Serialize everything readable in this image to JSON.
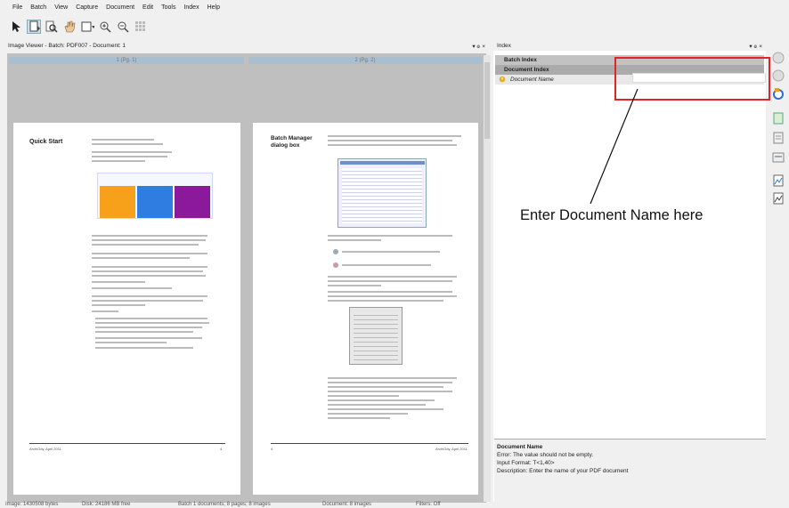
{
  "menu": [
    "File",
    "Batch",
    "View",
    "Capture",
    "Document",
    "Edit",
    "Tools",
    "Index",
    "Help"
  ],
  "toolbar_icons": [
    "arrow-icon",
    "select-page-icon",
    "magnify-icon",
    "hand-icon",
    "fit-page-icon",
    "zoom-in-icon",
    "zoom-out-icon",
    "thumbnails-icon"
  ],
  "viewer": {
    "title": "Image Viewer - Batch: PDF007 - Document: 1",
    "controls": "▾ ๏ ×",
    "page1": {
      "label": "1 (Pg. 1)",
      "heading": "Quick Start",
      "footer_left": "ArchiOdy, April 2011",
      "footer_right": "4"
    },
    "page2": {
      "label": "2 (Pg. 2)",
      "heading": "Batch Manager dialog box",
      "footer_left": "4",
      "footer_right": "ArchiOdy, April 2011"
    }
  },
  "index": {
    "title": "Index",
    "controls": "▾ ๏ ×",
    "batch_index": "Batch Index",
    "document_index": "Document Index",
    "document_name_field": "Document Name"
  },
  "callout": "Enter Document Name here",
  "description": {
    "title": "Document Name",
    "error": "Error: The value should not be empty.",
    "format": "Input Format: T<1,40>",
    "text": "Description: Enter the name of your PDF document"
  },
  "status": {
    "image": "Image: 1430508 bytes",
    "disk": "Disk: 24186 MB free",
    "batch": "Batch 1 documents; 8 pages; 8 images",
    "document": "Document: 8 images",
    "filters": "Filters: Off"
  },
  "colors": {
    "highlight_box": "#e0242b",
    "page_header": "#a9bfcf",
    "batch_index_row": "#c2c2c2"
  }
}
